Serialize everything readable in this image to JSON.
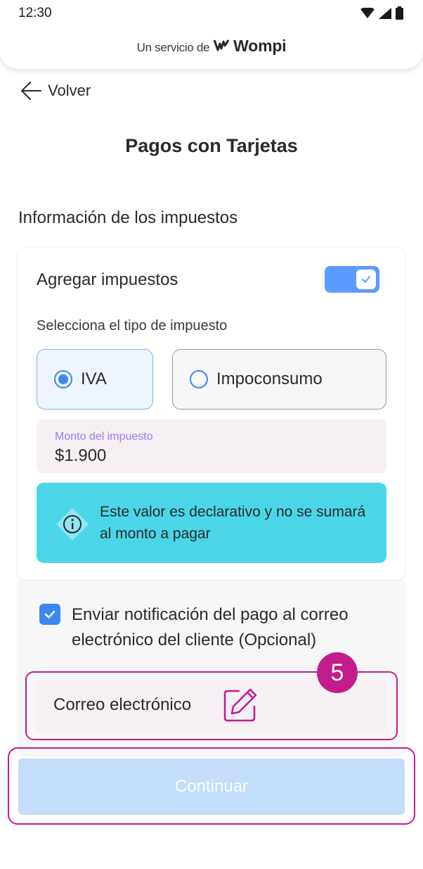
{
  "status_bar": {
    "time": "12:30"
  },
  "header": {
    "brand_prefix": "Un servicio de",
    "brand_name": "Wompi"
  },
  "nav": {
    "back_label": "Volver"
  },
  "page": {
    "title": "Pagos con Tarjetas",
    "section_title": "Información de los impuestos"
  },
  "taxes": {
    "toggle_label": "Agregar impuestos",
    "toggle_on": true,
    "select_label": "Selecciona el tipo de impuesto",
    "options": [
      {
        "label": "IVA",
        "selected": true
      },
      {
        "label": "Impoconsumo",
        "selected": false
      }
    ],
    "amount_label": "Monto del impuesto",
    "amount_value": "$1.900",
    "info_text": "Este valor es declarativo y no se sumará al monto a pagar"
  },
  "notification": {
    "checked": true,
    "label": "Enviar notificación del pago al correo electrónico del cliente (Opcional)",
    "email_placeholder": "Correo electrónico"
  },
  "step_badge": "5",
  "actions": {
    "continue_label": "Continuar"
  },
  "colors": {
    "accent": "#3c87f0",
    "highlight": "#c31c8c",
    "info_bg": "#4ad6e8",
    "button_disabled": "#c3ddfa"
  }
}
